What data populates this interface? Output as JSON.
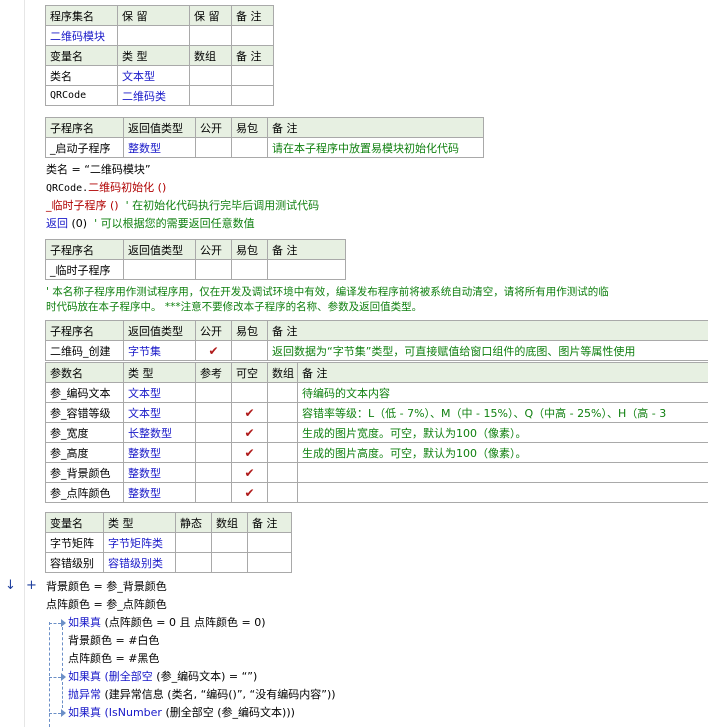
{
  "assembly_table": {
    "headers": [
      "程序集名",
      "保 留",
      "保 留",
      "备 注"
    ],
    "row": [
      "二维码模块",
      "",
      "",
      ""
    ]
  },
  "var_table1": {
    "headers": [
      "变量名",
      "类 型",
      "数组",
      "备 注"
    ],
    "rows": [
      [
        "类名",
        "文本型",
        "",
        ""
      ],
      [
        "QRCode",
        "二维码类",
        "",
        ""
      ]
    ]
  },
  "sub1": {
    "headers": [
      "子程序名",
      "返回值类型",
      "公开",
      "易包",
      "备 注"
    ],
    "row": [
      "_启动子程序",
      "整数型",
      "",
      "",
      "请在本子程序中放置易模块初始化代码"
    ]
  },
  "code1": {
    "l1": "类名 = “二维码模块”",
    "l2_obj": "QRCode.",
    "l2_call": "二维码初始化 ()",
    "l3_call": "_临时子程序 ()",
    "l3_comment": "' 在初始化代码执行完毕后调用测试代码",
    "l4_kw": "返回",
    "l4_args": "(0)",
    "l4_comment": "' 可以根据您的需要返回任意数值"
  },
  "sub2": {
    "headers": [
      "子程序名",
      "返回值类型",
      "公开",
      "易包",
      "备 注"
    ],
    "row": [
      "_临时子程序",
      "",
      "",
      "",
      ""
    ]
  },
  "comment_block": {
    "line1": "' 本名称子程序用作测试程序用，仅在开发及调试环境中有效，编译发布程序前将被系统自动清空，请将所有用作测试的临",
    "line2": "时代码放在本子程序中。 ***注意不要修改本子程序的名称、参数及返回值类型。"
  },
  "sub3": {
    "headers": [
      "子程序名",
      "返回值类型",
      "公开",
      "易包",
      "备 注"
    ],
    "row": [
      "二维码_创建",
      "字节集",
      "✔",
      "",
      "返回数据为“字节集”类型，可直接赋值给窗口组件的底图、图片等属性使用"
    ]
  },
  "params": {
    "headers": [
      "参数名",
      "类 型",
      "参考",
      "可空",
      "数组",
      "备 注"
    ],
    "rows": [
      [
        "参_编码文本",
        "文本型",
        "",
        "",
        "",
        "待编码的文本内容"
      ],
      [
        "参_容错等级",
        "文本型",
        "",
        "✔",
        "",
        "容错率等级：L（低 - 7%）、M（中 - 15%）、Q（中高 - 25%）、H（高 - 3"
      ],
      [
        "参_宽度",
        "长整数型",
        "",
        "✔",
        "",
        "生成的图片宽度。可空，默认为100（像素）。"
      ],
      [
        "参_高度",
        "整数型",
        "",
        "✔",
        "",
        "生成的图片高度。可空，默认为100（像素）。"
      ],
      [
        "参_背景颜色",
        "整数型",
        "",
        "✔",
        "",
        ""
      ],
      [
        "参_点阵颜色",
        "整数型",
        "",
        "✔",
        "",
        ""
      ]
    ]
  },
  "local_vars": {
    "headers": [
      "变量名",
      "类 型",
      "静态",
      "数组",
      "备 注"
    ],
    "rows": [
      [
        "字节矩阵",
        "字节矩阵类",
        "",
        "",
        ""
      ],
      [
        "容错级别",
        "容错级别类",
        "",
        "",
        ""
      ]
    ]
  },
  "gutter": {
    "arrow": "↓",
    "plus": "+"
  },
  "code2": {
    "l1": "背景颜色 = 参_背景颜色",
    "l2": "点阵颜色 = 参_点阵颜色",
    "l3_kw": "如果真",
    "l3_rest": "(点阵颜色 = 0 且 点阵颜色 = 0)",
    "l4": "背景颜色 = #白色",
    "l5": "点阵颜色 = #黑色",
    "l6_kw": "如果真",
    "l6_fn": "(删全部空",
    "l6_rest": "(参_编码文本) = “”)",
    "l7_kw": "抛异常",
    "l7_rest": "(建异常信息 (类名, “编码()”, “没有编码内容”))",
    "l8_kw": "如果真",
    "l8_fn": "(IsNumber",
    "l8_rest": "(删全部空 (参_编码文本)))"
  }
}
